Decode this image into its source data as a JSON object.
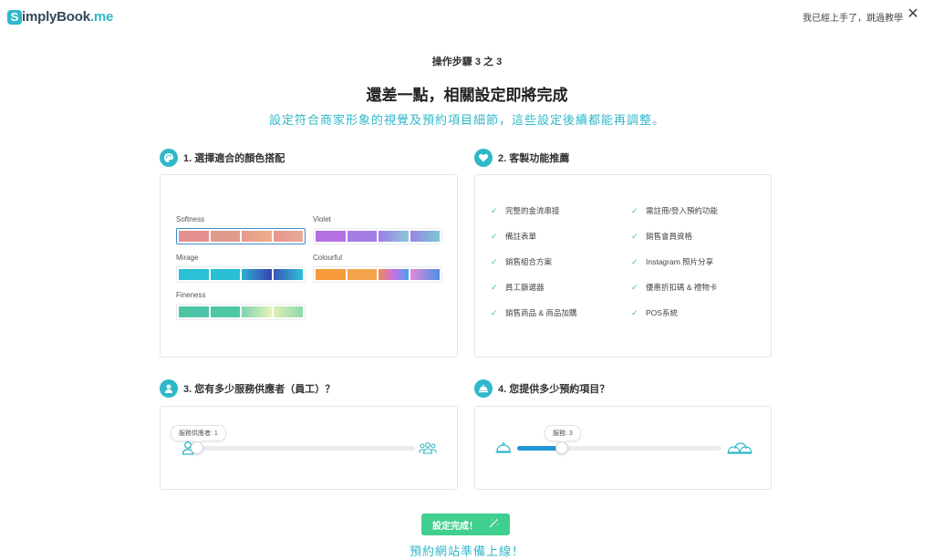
{
  "header": {
    "logo_mark": "S",
    "logo_brand": "implyBook",
    "logo_suffix": ".me",
    "skip_label": "我已經上手了，跳過教學",
    "close_icon": "close-icon"
  },
  "step_label": "操作步驟 3 之 3",
  "title": "還差一點，相關設定即將完成",
  "subtitle": "設定符合商家形象的視覺及預約項目細節，這些設定後續都能再調整。",
  "section1": {
    "label": "1. 選擇適合的顏色搭配",
    "icon": "palette-icon",
    "palettes": [
      {
        "name": "Softness",
        "selected": true,
        "colors": [
          "#e48f8f",
          "#df9b8d",
          "#eaa58c",
          "#e69d92"
        ]
      },
      {
        "name": "Violet",
        "selected": false,
        "colors": [
          "#b270e0",
          "#a57de6",
          "#8e9ce6",
          "#8cb3e8"
        ]
      },
      {
        "name": "Mirage",
        "selected": false,
        "colors": [
          "#2bc0d6",
          "#28bfd2",
          "#3a62c0",
          "#4679d0"
        ]
      },
      {
        "name": "Colourful",
        "selected": false,
        "colors": [
          "#f79a3a",
          "#f3a34a",
          "#d573e0",
          "#5b96e8"
        ]
      },
      {
        "name": "Fineness",
        "selected": false,
        "colors": [
          "#4ec4a6",
          "#4fc7a7",
          "#a8e0b4",
          "#c4eab0"
        ]
      }
    ]
  },
  "section2": {
    "label": "2. 客製功能推薦",
    "icon": "heart-icon",
    "features_left": [
      "完整的金流串接",
      "備註表單",
      "銷售組合方案",
      "員工篩選器",
      "銷售商品 & 商品加購"
    ],
    "features_right": [
      "需註冊/登入預約功能",
      "銷售會員資格",
      "Instagram 照片分享",
      "優惠折扣碼 & 禮物卡",
      "POS系統"
    ]
  },
  "section3": {
    "label": "3. 您有多少服務供應者（員工）？",
    "icon": "user-icon",
    "tooltip": "服務供應者: 1",
    "value": 1
  },
  "section4": {
    "label": "4. 您提供多少預約項目？",
    "icon": "cloche-icon",
    "tooltip": "服務: 3",
    "value": 3
  },
  "done_label": "設定完成！",
  "done_icon": "magic-wand-icon",
  "bottom_text": "預約網站準備上線！",
  "colors": {
    "accent": "#2fb8c9",
    "button": "#3fcf8e",
    "slider": "#2196d6",
    "check": "#3cc28b"
  }
}
